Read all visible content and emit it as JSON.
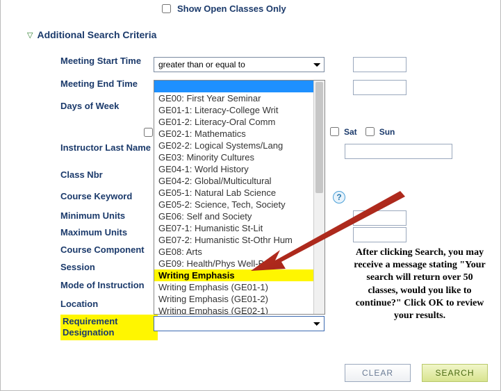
{
  "show_open_label": "Show Open Classes Only",
  "section_title": "Additional Search Criteria",
  "labels": {
    "meeting_start": "Meeting Start Time",
    "meeting_end": "Meeting End Time",
    "days_of_week": "Days of Week",
    "instructor_last_name": "Instructor Last Name",
    "class_nbr": "Class Nbr",
    "course_keyword": "Course Keyword",
    "min_units": "Minimum Units",
    "max_units": "Maximum Units",
    "course_component": "Course Component",
    "session": "Session",
    "mode": "Mode of Instruction",
    "location": "Location",
    "req_designation": "Requirement Designation"
  },
  "meeting_start_op": "greater than or equal to",
  "days": {
    "sat": "Sat",
    "sun": "Sun"
  },
  "dropdown_options": [
    "GE00: First Year Seminar",
    "GE01-1: Literacy-College Writ",
    "GE01-2: Literacy-Oral Comm",
    "GE02-1: Mathematics",
    "GE02-2: Logical Systems/Lang",
    "GE03: Minority Cultures",
    "GE04-1: World History",
    "GE04-2: Global/Multicultural",
    "GE05-1: Natural Lab Science",
    "GE05-2: Science, Tech, Society",
    "GE06: Self and Society",
    "GE07-1: Humanistic St-Lit",
    "GE07-2: Humanistic St-Othr Hum",
    "GE08: Arts",
    "GE09: Health/Phys Well-Being",
    "Writing Emphasis",
    "Writing Emphasis (GE01-1)",
    "Writing Emphasis (GE01-2)",
    "Writing Emphasis (GE02-1)"
  ],
  "highlighted_option_index": 15,
  "annotation_text": "After clicking Search, you may receive a message stating \"Your search will return over 50 classes, would you like to continue?\" Click OK to review your results.",
  "buttons": {
    "clear": "CLEAR",
    "search": "SEARCH"
  },
  "help_char": "?"
}
